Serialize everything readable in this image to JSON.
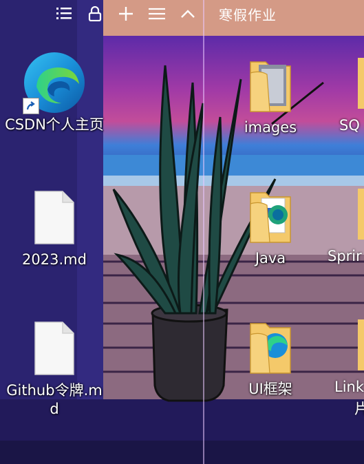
{
  "fence": {
    "title": "寒假作业",
    "toolbar": [
      {
        "icon": "list-icon"
      },
      {
        "icon": "lock-icon"
      },
      {
        "icon": "plus-icon"
      },
      {
        "icon": "menu-icon"
      },
      {
        "icon": "chevron-up-icon"
      }
    ]
  },
  "left_icons": [
    {
      "label": "CSDN个人主页",
      "icon": "edge-icon",
      "shortcut": true
    },
    {
      "label": "2023.md",
      "icon": "file-icon"
    },
    {
      "label": "Github令牌.md",
      "icon": "file-icon"
    }
  ],
  "fence_icons": [
    {
      "label": "images",
      "icon": "folder-icon"
    },
    {
      "label": "Java",
      "icon": "folder-icon"
    },
    {
      "label": "UI框架",
      "icon": "folder-icon"
    }
  ],
  "cut_icons": [
    {
      "label": "SQ"
    },
    {
      "label": "Sprir"
    },
    {
      "label": "Link"
    },
    {
      "label": "片"
    }
  ],
  "colors": {
    "desktop_bg": "#2a1f5e",
    "sky": "#8a2f9c",
    "fence_header": "#d49a86",
    "folder": "#f4c96a"
  }
}
